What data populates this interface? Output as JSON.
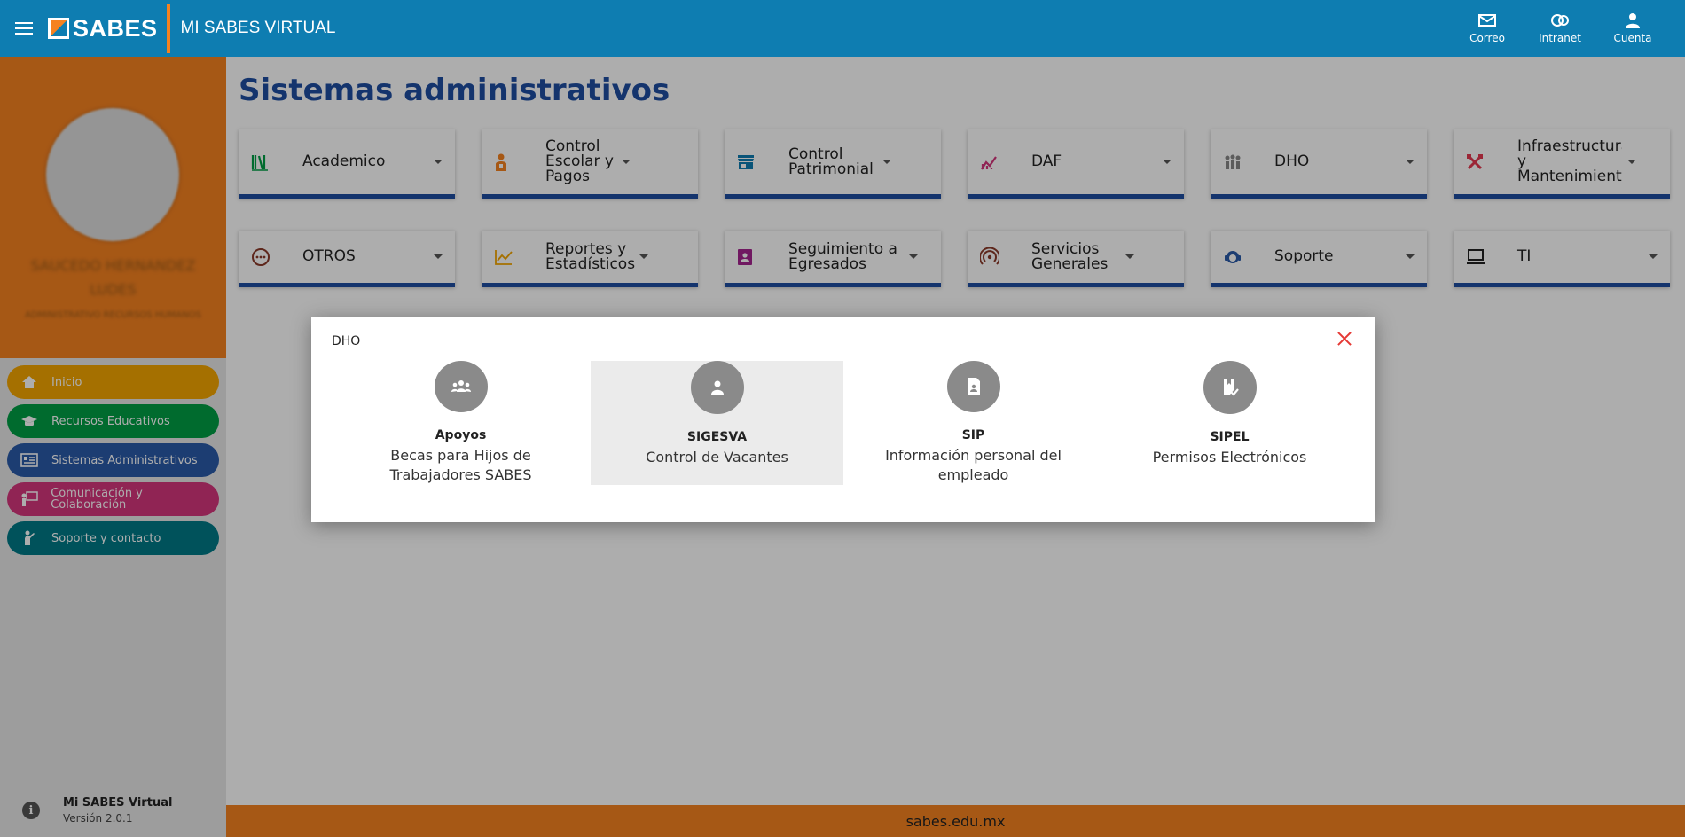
{
  "header": {
    "logo_text": "SABES",
    "app_title": "MI SABES VIRTUAL",
    "actions": [
      {
        "label": "Correo",
        "icon": "mail-icon"
      },
      {
        "label": "Intranet",
        "icon": "intranet-icon"
      },
      {
        "label": "Cuenta",
        "icon": "account-icon"
      }
    ]
  },
  "sidebar": {
    "profile_name": "SAUCEDO HERNANDEZ LUDES",
    "profile_role": "ADMINISTRATIVO RECURSOS HUMANOS",
    "items": [
      {
        "label": "Inicio",
        "color": "#f4a600",
        "icon": "home-icon"
      },
      {
        "label": "Recursos Educativos",
        "color": "#009e45",
        "icon": "graduation-cap-icon"
      },
      {
        "label": "Sistemas Administrativos",
        "color": "#2a5aa8",
        "icon": "monitor-list-icon"
      },
      {
        "label": "Comunicación y Colaboración",
        "color": "#d4357c",
        "icon": "presentation-icon"
      },
      {
        "label": "Soporte y contacto",
        "color": "#007a87",
        "icon": "person-wave-icon"
      }
    ],
    "footer_title": "Mi SABES Virtual",
    "footer_version": "Versión 2.0.1"
  },
  "main": {
    "title": "Sistemas administrativos",
    "cards_row1": [
      {
        "label": "Academico",
        "icon": "books-icon",
        "icon_color": "#009e45"
      },
      {
        "label": "Control Escolar y Pagos",
        "icon": "student-icon",
        "icon_color": "#f58220"
      },
      {
        "label": "Control Patrimonial",
        "icon": "store-icon",
        "icon_color": "#0e7db1"
      },
      {
        "label": "DAF",
        "icon": "finance-chart-icon",
        "icon_color": "#d4357c"
      },
      {
        "label": "DHO",
        "icon": "people-group-icon",
        "icon_color": "#888888"
      },
      {
        "label": "Infraestructura y Mantenimiento",
        "icon": "tools-icon",
        "icon_color": "#e53950"
      }
    ],
    "cards_row2": [
      {
        "label": "OTROS",
        "icon": "more-circle-icon",
        "icon_color": "#8b3a2a"
      },
      {
        "label": "Reportes y Estadísticos",
        "icon": "line-chart-icon",
        "icon_color": "#f4a600"
      },
      {
        "label": "Seguimiento a Egresados",
        "icon": "contact-book-icon",
        "icon_color": "#a6248f"
      },
      {
        "label": "Servicios Generales",
        "icon": "signal-icon",
        "icon_color": "#8b3a2a"
      },
      {
        "label": "Soporte",
        "icon": "support-agent-icon",
        "icon_color": "#2a5aa8"
      },
      {
        "label": "TI",
        "icon": "laptop-icon",
        "icon_color": "#222222"
      }
    ],
    "footer_text": "sabes.edu.mx"
  },
  "modal": {
    "title": "DHO",
    "options": [
      {
        "name": "Apoyos",
        "desc": "Becas para Hijos de Trabajadores SABES",
        "icon": "group-icon"
      },
      {
        "name": "SIGESVA",
        "desc": "Control de Vacantes",
        "icon": "person-icon"
      },
      {
        "name": "SIP",
        "desc": "Información personal del empleado",
        "icon": "document-person-icon"
      },
      {
        "name": "SIPEL",
        "desc": "Permisos Electrónicos",
        "icon": "book-check-icon"
      }
    ]
  }
}
